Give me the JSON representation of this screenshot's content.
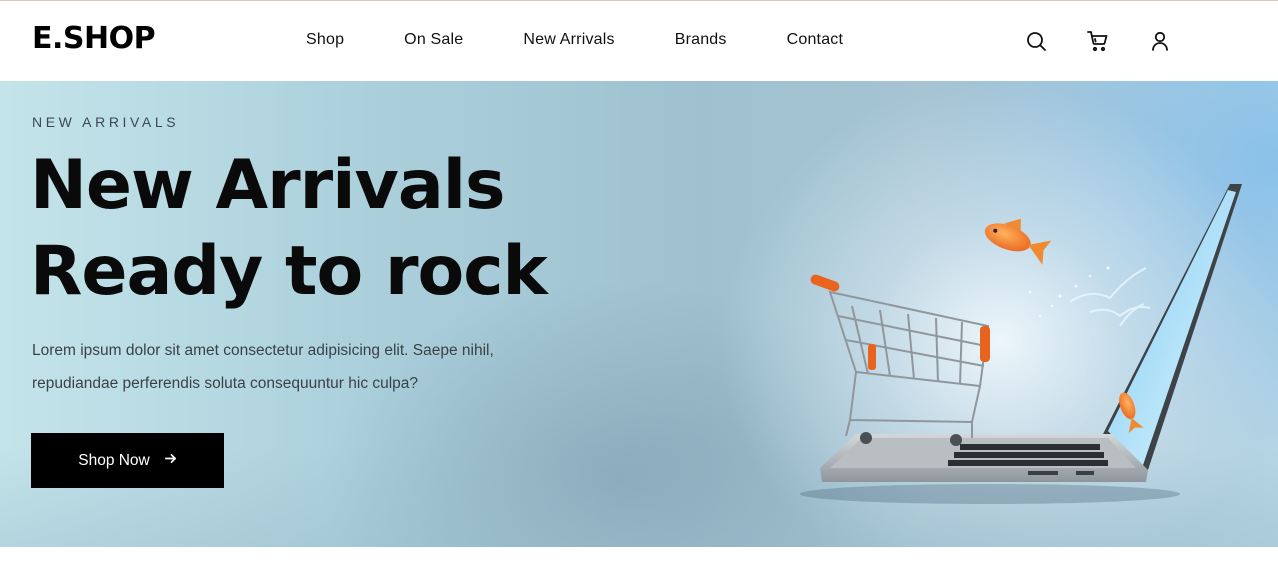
{
  "brand": {
    "logo": "E.SHOP"
  },
  "nav": {
    "items": [
      {
        "label": "Shop"
      },
      {
        "label": "On Sale"
      },
      {
        "label": "New Arrivals"
      },
      {
        "label": "Brands"
      },
      {
        "label": "Contact"
      }
    ]
  },
  "header_icons": [
    "search-icon",
    "cart-icon",
    "user-icon"
  ],
  "hero": {
    "eyebrow": "NEW ARRIVALS",
    "headline_line1": "New Arrivals",
    "headline_line2": "Ready to rock",
    "description_line1": "Lorem ipsum dolor sit amet consectetur adipisicing elit. Saepe nihil,",
    "description_line2": "repudiandae perferendis soluta consequuntur hic culpa?",
    "cta_label": "Shop Now",
    "cta_icon": "arrow-right-icon",
    "image_subject": "shopping cart on laptop with goldfish jumping out of screen"
  },
  "colors": {
    "cta_background": "#000000",
    "cta_text": "#ffffff",
    "accent_orange": "#e8641e"
  }
}
